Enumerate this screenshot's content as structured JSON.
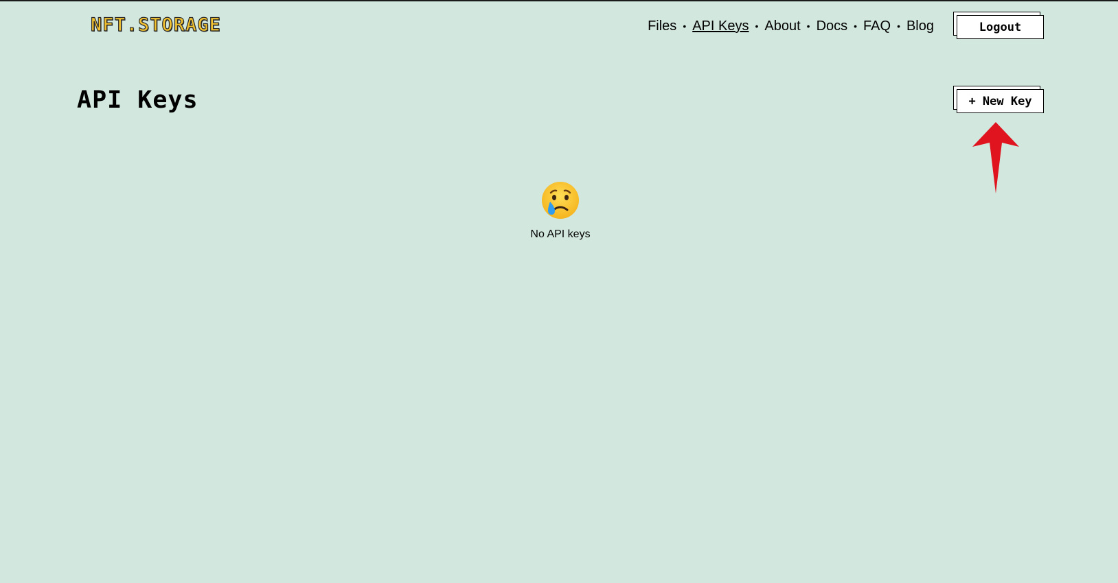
{
  "header": {
    "logo_text": "NFT.STORAGE",
    "nav": [
      {
        "label": "Files"
      },
      {
        "label": "API Keys",
        "active": true
      },
      {
        "label": "About"
      },
      {
        "label": "Docs"
      },
      {
        "label": "FAQ"
      },
      {
        "label": "Blog"
      }
    ],
    "separator": "•",
    "logout_label": "Logout"
  },
  "main": {
    "title": "API Keys",
    "new_key_label": "+ New Key",
    "empty_state": {
      "icon": "crying-face-icon",
      "text": "No API keys"
    }
  },
  "annotation": {
    "icon": "red-arrow-up-icon",
    "color": "#e0141e"
  },
  "colors": {
    "background": "#d2e7de",
    "logo_fill": "#f2c230",
    "text": "#000000"
  }
}
